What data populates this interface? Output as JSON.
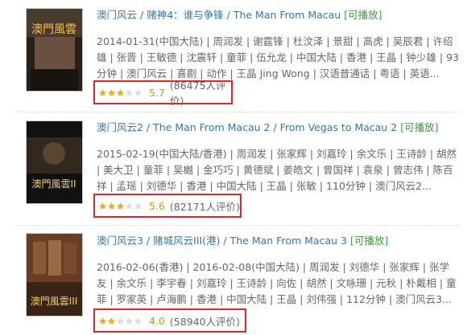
{
  "items": [
    {
      "title": "澳门风云",
      "alt_title": "赌神4：谁与争锋",
      "en_title": "The Man From Macau",
      "playable": "[可播放]",
      "meta": "2014-01-31(中国大陆) | 周润发 | 谢霆锋 | 杜汶泽 | 景甜 | 高虎 | 吴辰君 | 许绍雄 | 张晋 | 王敏德 | 沈震轩 | 童菲 | 伍允龙 | 中国大陆 | 香港 | 王晶 | 钟少雄 | 93分钟 | 澳门风云 | 喜剧 | 动作 | 王晶 Jing Wong | 汉语普通话 | 粤语 | 英语...",
      "score": "5.7",
      "votes": "(86475人评价)",
      "stars": 3
    },
    {
      "title": "澳门风云2",
      "alt_title": "The Man From Macau 2",
      "en_title": "From Vegas to Macau 2",
      "playable": "[可播放]",
      "meta": "2015-02-19(中国大陆/香港) | 周润发 | 张家辉 | 刘嘉玲 | 余文乐 | 王诗龄 | 胡然 | 美大卫 | 童菲 | 吴樾 | 金巧巧 | 黄德斌 | 姜皓文 | 曾国祥 | 袁泉 | 曾志伟 | 陈百祥 | 孟瑶 | 刘德华 | 香港 | 中国大陆 | 王晶 | 张敏 | 110分钟 | 澳门风云2...",
      "score": "5.6",
      "votes": "(82171人评价)",
      "stars": 3
    },
    {
      "title": "澳门风云3",
      "alt_title": "赌城风云III(港)",
      "en_title": "The Man From Macau 3",
      "playable": "[可播放]",
      "meta": "2016-02-06(香港) | 2016-02-08(中国大陆) | 周润发 | 刘德华 | 张家辉 | 张学友 | 余文乐 | 李宇春 | 刘嘉玲 | 王诗龄 | 向佐 | 胡然 | 文咏珊 | 元秋 | 朴戴相 | 童菲 | 罗家英 | 卢海鹏 | 香港 | 中国大陆 | 王晶 | 刘伟强 | 112分钟 | 澳门风云3...",
      "score": "4.0",
      "votes": "(58940人评价)",
      "stars": 2
    }
  ],
  "colors": {
    "link": "#3377aa",
    "playable": "#3b9b3b",
    "score": "#e09015",
    "highlight_box": "#e0262b",
    "star_on": "#f5a623",
    "star_off": "#dddddd"
  }
}
